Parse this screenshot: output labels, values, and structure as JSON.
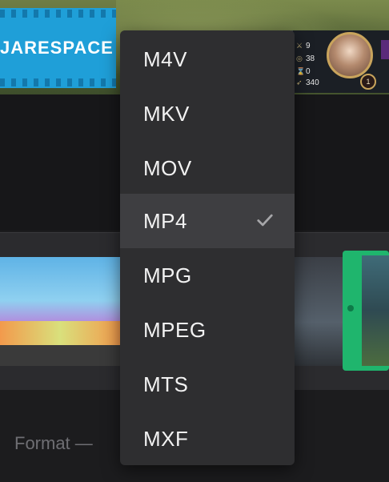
{
  "preview": {
    "sponsor_text": "JARESPACE",
    "hud": {
      "stat_1": "9",
      "stat_2": "38",
      "stat_3": "0",
      "stat_4": "340",
      "level": "1"
    }
  },
  "format_section": {
    "label": "Format —"
  },
  "format_menu": {
    "items": [
      {
        "label": "M4V",
        "selected": false
      },
      {
        "label": "MKV",
        "selected": false
      },
      {
        "label": "MOV",
        "selected": false
      },
      {
        "label": "MP4",
        "selected": true
      },
      {
        "label": "MPG",
        "selected": false
      },
      {
        "label": "MPEG",
        "selected": false
      },
      {
        "label": "MTS",
        "selected": false
      },
      {
        "label": "MXF",
        "selected": false
      }
    ]
  }
}
